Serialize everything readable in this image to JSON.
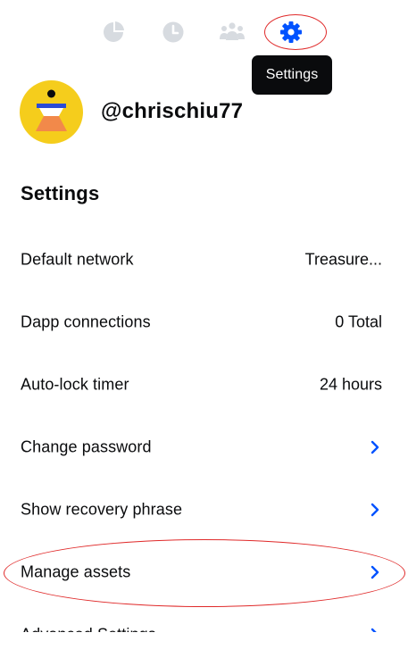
{
  "nav": {
    "items": [
      {
        "id": "portfolio",
        "icon": "pie-chart-icon"
      },
      {
        "id": "activity",
        "icon": "clock-icon"
      },
      {
        "id": "people",
        "icon": "people-icon"
      },
      {
        "id": "settings",
        "icon": "gear-icon",
        "active": true
      }
    ],
    "tooltip": "Settings",
    "inactive_color": "#d7dbe0",
    "active_color": "#0052ff"
  },
  "profile": {
    "username": "@chrischiu77",
    "avatar_bg": "#f5cd1c"
  },
  "settings": {
    "title": "Settings",
    "rows": [
      {
        "label": "Default network",
        "value": "Treasure..."
      },
      {
        "label": "Dapp connections",
        "value": "0 Total"
      },
      {
        "label": "Auto-lock timer",
        "value": "24 hours"
      },
      {
        "label": "Change password",
        "chevron": true
      },
      {
        "label": "Show recovery phrase",
        "chevron": true
      },
      {
        "label": "Manage assets",
        "chevron": true
      },
      {
        "label": "Advanced Settings",
        "chevron": true
      }
    ]
  },
  "colors": {
    "accent": "#0052ff",
    "annotation": "#e02a2a",
    "text": "#0a0b0d"
  }
}
